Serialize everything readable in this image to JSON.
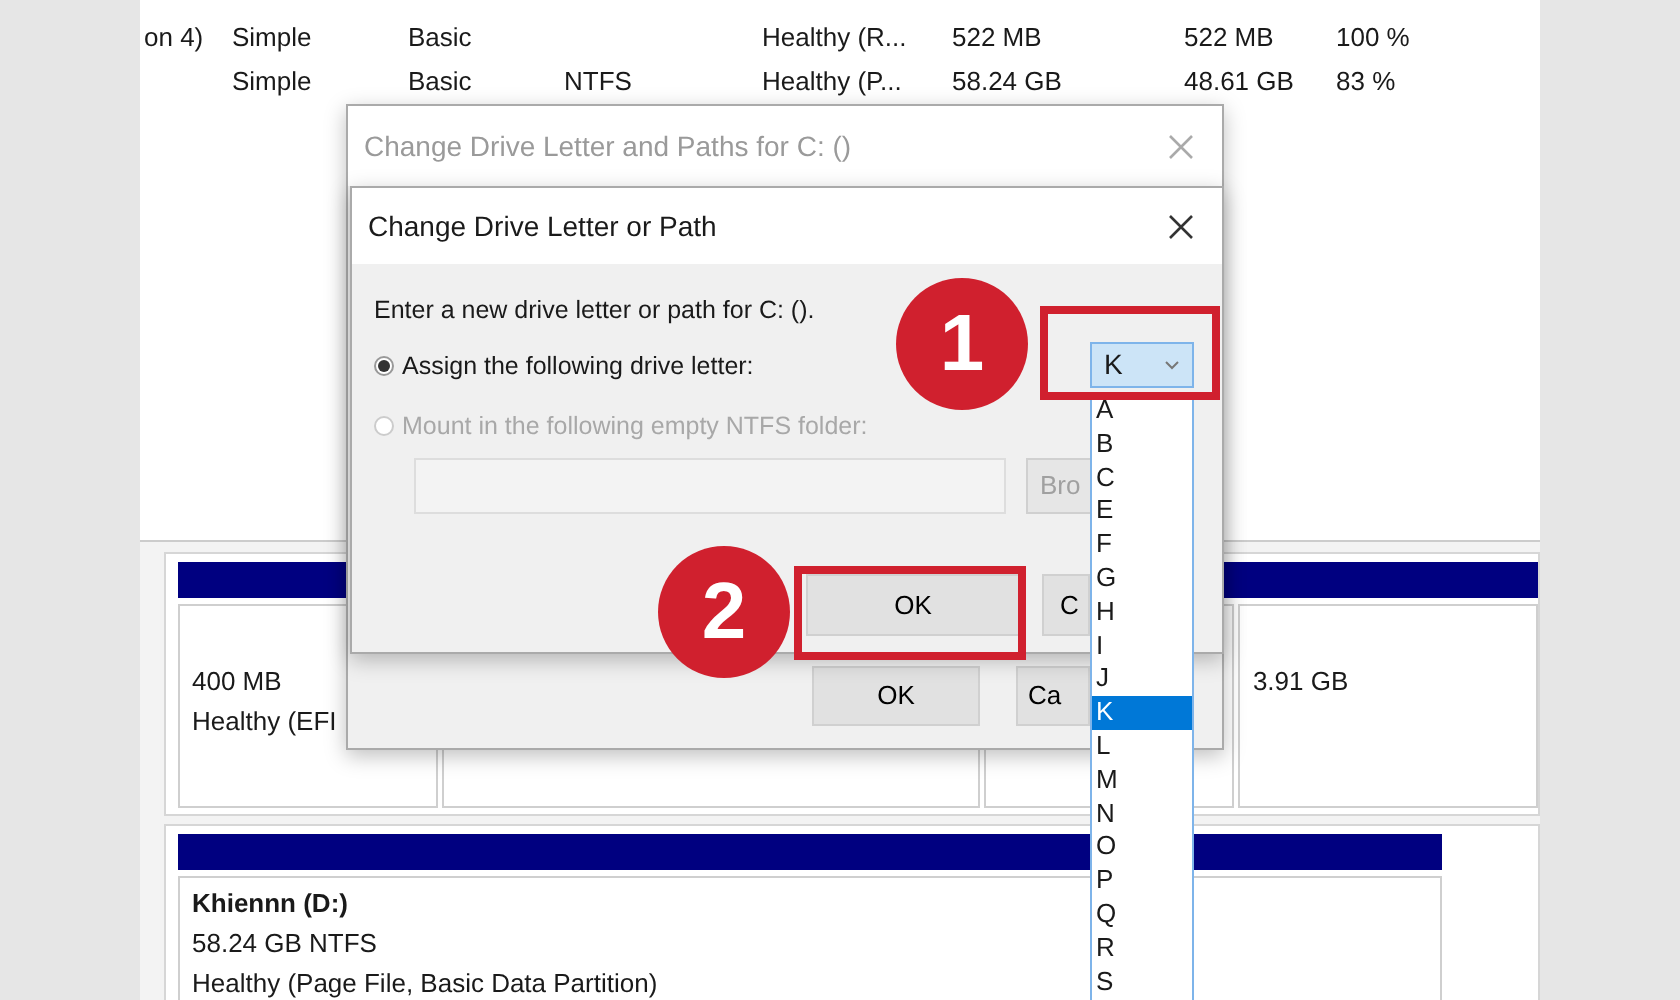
{
  "volume_rows": [
    {
      "column_1": "on 4)",
      "column_2": "Simple",
      "column_3": "Basic",
      "column_5": "Healthy (R...",
      "column_6": "522 MB",
      "column_7": "522 MB",
      "column_8": "100 %"
    },
    {
      "column_2": "Simple",
      "column_3": "Basic",
      "column_4": "NTFS",
      "column_5": "Healthy (P...",
      "column_6": "58.24 GB",
      "column_7": "48.61 GB",
      "column_8": "83 %"
    }
  ],
  "disks": [
    {
      "partitions": [
        {
          "kind": "text",
          "lines": [
            "400 MB",
            "Healthy (EFI"
          ]
        },
        {
          "kind": "blank"
        },
        {
          "kind": "blank"
        },
        {
          "kind": "text",
          "lines": [
            "3.91 GB"
          ]
        }
      ]
    },
    {
      "partitions": [
        {
          "kind": "text",
          "title": "Khiennn  (D:)",
          "lines": [
            "58.24 GB NTFS",
            "Healthy (Page File, Basic Data Partition)"
          ]
        }
      ]
    }
  ],
  "back_dialog": {
    "title": "Change Drive Letter and Paths for C: ()",
    "active": false,
    "buttons": [
      {
        "label": "OK"
      },
      {
        "label": "Ca"
      }
    ]
  },
  "front_dialog": {
    "title": "Change Drive Letter or Path",
    "active": true,
    "prompt": "Enter a new drive letter or path for C: ().",
    "options": [
      {
        "label": "Assign the following drive letter:",
        "selected": true,
        "disabled": false
      },
      {
        "label": "Mount in the following empty NTFS folder:",
        "selected": false,
        "disabled": true
      }
    ],
    "folder_field": {
      "disabled": true
    },
    "browse_button": {
      "label": "Bro",
      "disabled": true
    },
    "buttons": [
      {
        "label": "OK"
      },
      {
        "label": "C"
      }
    ]
  },
  "drive_letter": {
    "value": "K",
    "expanded": true,
    "options": [
      {
        "label": "A",
        "selected": false
      },
      {
        "label": "B",
        "selected": false
      },
      {
        "label": "C",
        "selected": false
      },
      {
        "label": "E",
        "selected": false
      },
      {
        "label": "F",
        "selected": false
      },
      {
        "label": "G",
        "selected": false
      },
      {
        "label": "H",
        "selected": false
      },
      {
        "label": "I",
        "selected": false
      },
      {
        "label": "J",
        "selected": false
      },
      {
        "label": "K",
        "selected": true
      },
      {
        "label": "L",
        "selected": false
      },
      {
        "label": "M",
        "selected": false
      },
      {
        "label": "N",
        "selected": false
      },
      {
        "label": "O",
        "selected": false
      },
      {
        "label": "P",
        "selected": false
      },
      {
        "label": "Q",
        "selected": false
      },
      {
        "label": "R",
        "selected": false
      },
      {
        "label": "S",
        "selected": false
      }
    ]
  },
  "annotations": [
    {
      "number": "1"
    },
    {
      "number": "2"
    }
  ]
}
